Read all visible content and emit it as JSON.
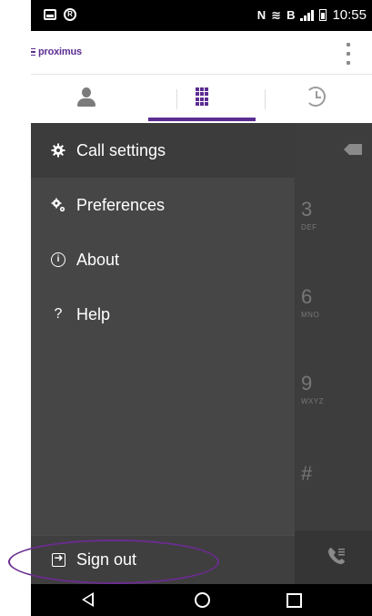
{
  "status_bar": {
    "time": "10:55",
    "icons": [
      "screenshot-icon",
      "data-saver-icon",
      "nfc-icon",
      "wifi-icon",
      "battery-saver-icon",
      "signal-icon",
      "battery-icon"
    ]
  },
  "app_bar": {
    "logo_text": "proximus",
    "logo_icon": "menu-lines-icon",
    "overflow_icon": "overflow-menu-icon"
  },
  "tabs": [
    {
      "name": "contacts",
      "icon": "person-icon",
      "selected": false
    },
    {
      "name": "keypad",
      "icon": "dialpad-icon",
      "selected": true
    },
    {
      "name": "history",
      "icon": "history-icon",
      "selected": false
    }
  ],
  "drawer": {
    "items": [
      {
        "label": "Call settings",
        "icon": "gear-icon"
      },
      {
        "label": "Preferences",
        "icon": "gears-icon"
      },
      {
        "label": "About",
        "icon": "info-icon"
      },
      {
        "label": "Help",
        "icon": "help-icon"
      }
    ],
    "sign_out": {
      "label": "Sign out",
      "icon": "sign-out-icon"
    }
  },
  "dialer": {
    "keys": [
      {
        "digit": "3",
        "letters": "DEF"
      },
      {
        "digit": "6",
        "letters": "MNO"
      },
      {
        "digit": "9",
        "letters": "WXYZ"
      },
      {
        "digit": "#",
        "letters": ""
      }
    ]
  },
  "colors": {
    "brand": "#5c2d91",
    "drawer_bg": "#464646",
    "annotation": "#6a2c8f"
  }
}
